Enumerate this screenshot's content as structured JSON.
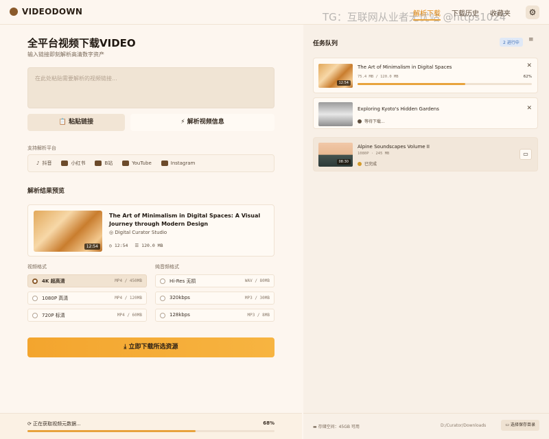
{
  "header": {
    "brand": "VIDEODOWN",
    "nav": [
      "解析下载",
      "下载历史",
      "收藏夹"
    ],
    "watermark": "TG：互联网从业者无忧站 @https1024"
  },
  "hero": {
    "title": "全平台视频下载VIDEO",
    "subtitle": "输入链接即刻解析高清数字资产",
    "placeholder": "在此处粘贴需要解析的视频链接..."
  },
  "actions": {
    "paste": "粘贴链接",
    "parse": "解析视频信息"
  },
  "platforms": {
    "label": "支持解析平台",
    "items": [
      "抖音",
      "小红书",
      "B站",
      "YouTube",
      "Instagram"
    ]
  },
  "result": {
    "section": "解析结果预览",
    "title": "The Art of Minimalism in Digital Spaces: A Visual Journey through Modern Design",
    "channel": "Digital Curator Studio",
    "duration": "12:54",
    "duration_thumb": "12:54",
    "size": "120.0 MB"
  },
  "video_formats": {
    "label": "视频格式",
    "options": [
      {
        "name": "4K 超高清",
        "meta": "MP4 / 450MB",
        "selected": true
      },
      {
        "name": "1080P 高清",
        "meta": "MP4 / 120MB",
        "selected": false
      },
      {
        "name": "720P 标清",
        "meta": "MP4 / 60MB",
        "selected": false
      }
    ]
  },
  "audio_formats": {
    "label": "纯音频格式",
    "options": [
      {
        "name": "Hi-Res 无损",
        "meta": "WAV / 80MB"
      },
      {
        "name": "320kbps",
        "meta": "MP3 / 30MB"
      },
      {
        "name": "128kbps",
        "meta": "MP3 / 8MB"
      }
    ]
  },
  "download": {
    "label": "立即下载所选资源"
  },
  "status": {
    "text": "正在获取视频元数据...",
    "percent_label": "68%",
    "percent": 68
  },
  "queue": {
    "title": "任务队列",
    "badge": "2 进行中",
    "items": [
      {
        "title": "The Art of Minimalism in Digital Spaces",
        "meta": "75.4 MB / 120.0 MB",
        "percent_label": "62%",
        "percent": 62,
        "duration": "12:54"
      },
      {
        "title": "Exploring Kyoto's Hidden Gardens",
        "status": "等待下载..."
      },
      {
        "title": "Alpine Soundscapes Volume II",
        "meta": "1080P · 245 MB",
        "status": "已完成",
        "duration": "08:30"
      }
    ]
  },
  "footer": {
    "storage": "存储空间：45GB 可用",
    "path": "D:/Curator/Downloads",
    "choose_dir": "选择保存目录"
  }
}
